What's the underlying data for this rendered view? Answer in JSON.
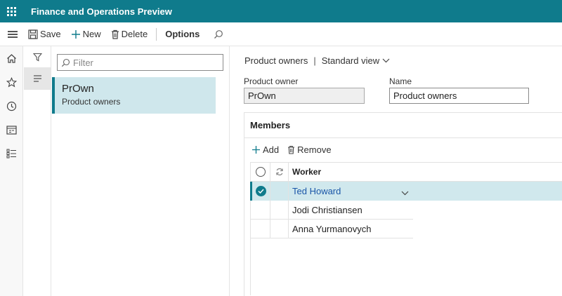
{
  "app": {
    "title": "Finance and Operations Preview"
  },
  "toolbar": {
    "save_label": "Save",
    "new_label": "New",
    "delete_label": "Delete",
    "options_label": "Options"
  },
  "nav": {
    "icons": [
      "home-icon",
      "star-icon",
      "clock-icon",
      "workspace-icon",
      "modules-list-icon"
    ]
  },
  "list": {
    "filter_placeholder": "Filter",
    "items": [
      {
        "title": "PrOwn",
        "subtitle": "Product owners"
      }
    ]
  },
  "detail": {
    "breadcrumb": "Product owners",
    "breadcrumb_separator": "|",
    "view_name": "Standard view",
    "product_owner_label": "Product owner",
    "product_owner_value": "PrOwn",
    "name_label": "Name",
    "name_value": "Product owners"
  },
  "members": {
    "title": "Members",
    "add_label": "Add",
    "remove_label": "Remove",
    "column_worker": "Worker",
    "rows": [
      {
        "worker": "Ted Howard",
        "selected": true
      },
      {
        "worker": "Jodi Christiansen",
        "selected": false
      },
      {
        "worker": "Anna Yurmanovych",
        "selected": false
      }
    ]
  },
  "colors": {
    "brand": "#0f7b8c",
    "selected_row": "#d0e8ed",
    "link_text": "#1a56a8"
  }
}
